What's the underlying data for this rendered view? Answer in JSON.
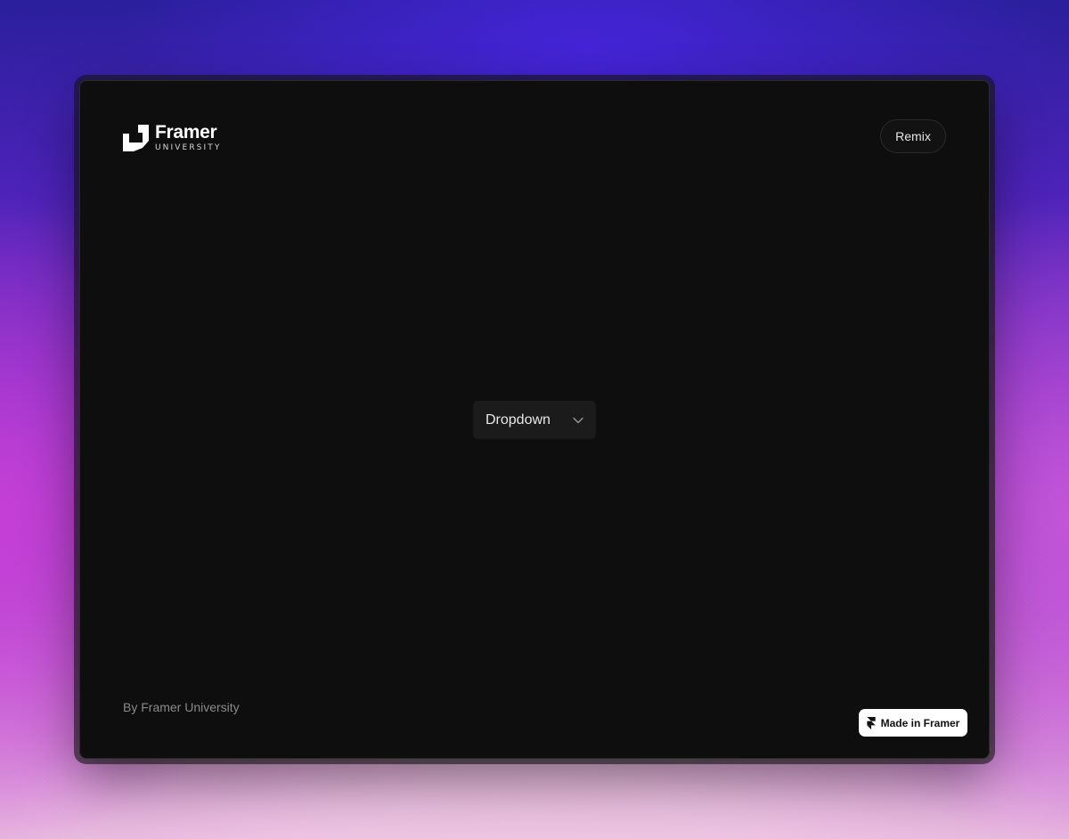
{
  "brand": {
    "name": "Framer",
    "subtitle": "UNIVERSITY",
    "logo_icon": "framer-university-logo"
  },
  "header": {
    "remix_label": "Remix"
  },
  "main": {
    "dropdown_label": "Dropdown",
    "dropdown_icon": "chevron-down-icon"
  },
  "footer": {
    "byline": "By Framer University",
    "badge_label": "Made in Framer",
    "badge_icon": "framer-icon"
  },
  "colors": {
    "panel_background": "#0e0e0e",
    "dropdown_background": "#1b1b1b",
    "badge_background": "#ffffff"
  }
}
